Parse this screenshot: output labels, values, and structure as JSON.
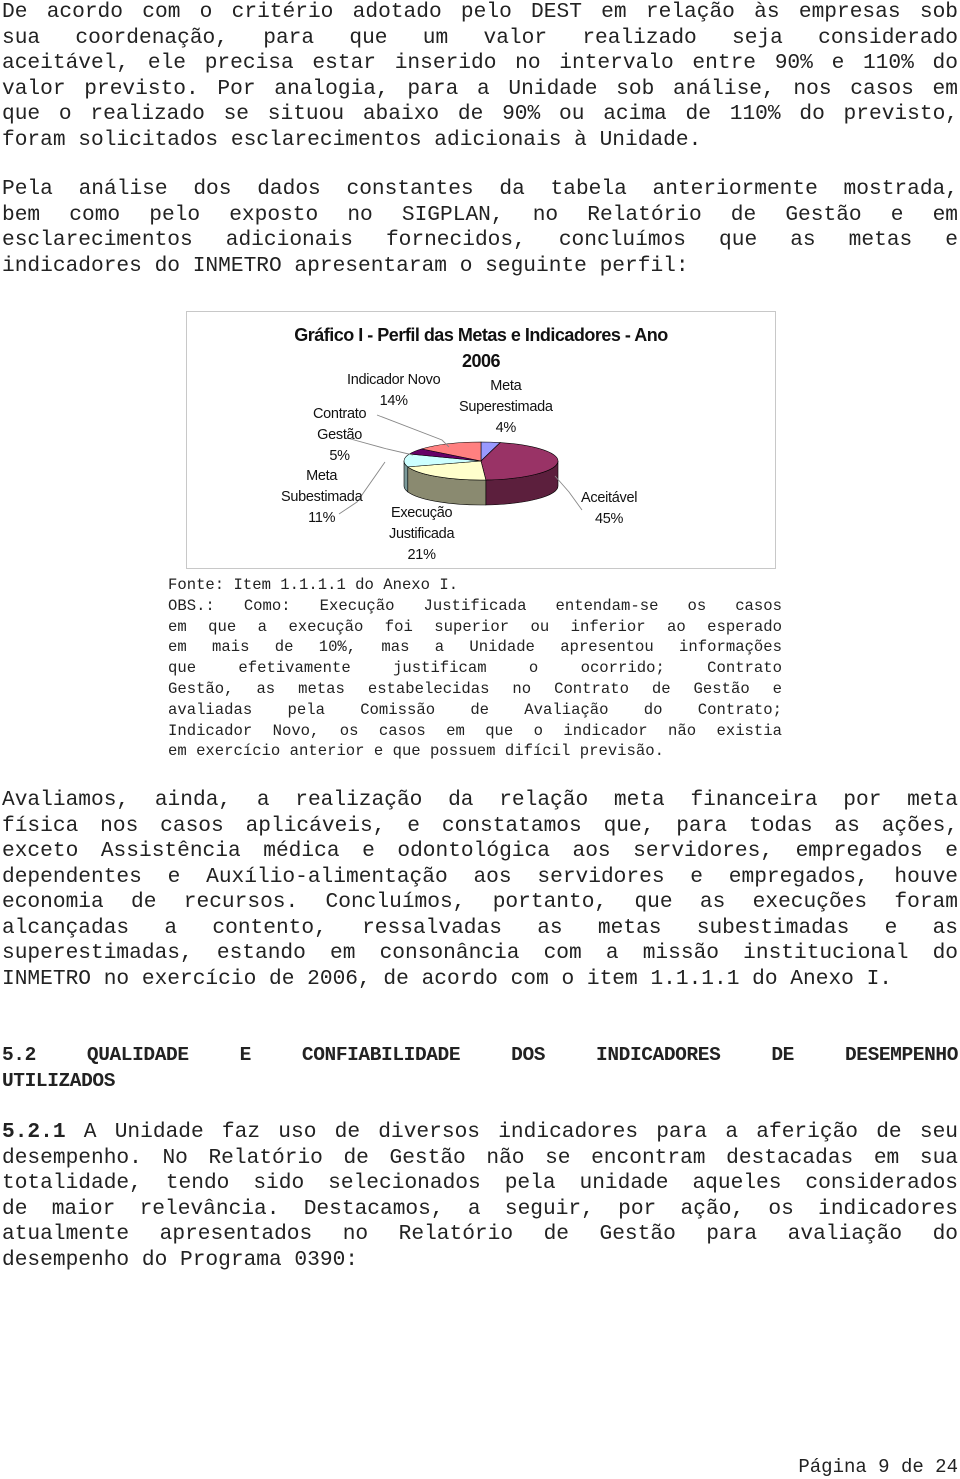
{
  "paragraph1": {
    "lines": [
      "De acordo com o critério adotado pelo DEST em relação às empresas sob",
      "sua coordenação, para que um valor realizado seja considerado",
      "aceitável, ele precisa estar inserido no intervalo entre 90% e 110% do",
      "valor previsto. Por analogia, para a Unidade sob análise, nos casos em",
      "que o realizado se situou abaixo de 90% ou acima de 110% do previsto,",
      "foram solicitados esclarecimentos adicionais à Unidade."
    ]
  },
  "paragraph2": {
    "lines": [
      "Pela análise dos dados constantes da tabela anteriormente mostrada,",
      "bem como pelo exposto no SIGPLAN, no Relatório de Gestão e em",
      "esclarecimentos adicionais fornecidos, concluímos que as metas e",
      "indicadores do INMETRO apresentaram o seguinte perfil:"
    ]
  },
  "chart_data": {
    "type": "pie",
    "title": "Gráfico I - Perfil das Metas e Indicadores - Ano 2006",
    "title_lines": [
      "Gráfico I - Perfil das Metas e Indicadores - Ano",
      "2006"
    ],
    "style": "3d-exploded-none",
    "slices": [
      {
        "label": "Meta Superestimada",
        "label_lines": [
          "Meta",
          "Superestimada",
          "4%"
        ],
        "value": 4,
        "color": "#9999ff",
        "side": "#5c5c99"
      },
      {
        "label": "Aceitável",
        "label_lines": [
          "Aceitável",
          "45%"
        ],
        "value": 45,
        "color": "#993366",
        "side": "#5c1f3d"
      },
      {
        "label": "Execução Justificada",
        "label_lines": [
          "Execução",
          "Justificada",
          "21%"
        ],
        "value": 21,
        "color": "#ffffcc",
        "side": "#8a8a70"
      },
      {
        "label": "Meta Subestimada",
        "label_lines": [
          "Meta",
          "Subestimada",
          "11%"
        ],
        "value": 11,
        "color": "#ccffff",
        "side": "#7a9999"
      },
      {
        "label": "Contrato Gestão",
        "label_lines": [
          "Contrato",
          "Gestão",
          "5%"
        ],
        "value": 5,
        "color": "#660066",
        "side": "#3d003d"
      },
      {
        "label": "Indicador Novo",
        "label_lines": [
          "Indicador Novo",
          "14%"
        ],
        "value": 14,
        "color": "#ff8080",
        "side": "#994d4d"
      }
    ],
    "legend": "none (data labels with leader lines)"
  },
  "source_note": {
    "lines": [
      "Fonte: Item 1.1.1.1 do Anexo I.",
      "OBS.: Como: Execução Justificada entendam-se os casos",
      "em que a execução foi superior ou inferior ao esperado",
      "em mais de 10%, mas a Unidade apresentou informações",
      "que efetivamente justificam o ocorrido; Contrato",
      "Gestão, as metas estabelecidas no Contrato de Gestão e",
      "avaliadas pela Comissão de Avaliação do Contrato;",
      "Indicador Novo, os casos em que o indicador não existia",
      "em exercício anterior e que possuem difícil previsão."
    ]
  },
  "paragraph3": {
    "lines": [
      "Avaliamos, ainda, a realização da relação meta financeira por meta",
      "física nos casos aplicáveis, e constatamos que, para todas as ações,",
      "exceto Assistência médica e odontológica aos servidores, empregados e",
      "dependentes e Auxílio-alimentação aos servidores e empregados, houve",
      "economia de recursos. Concluímos, portanto, que as execuções foram",
      "alcançadas a contento, ressalvadas as metas subestimadas e as",
      "superestimadas, estando em consonância com a missão institucional do",
      "INMETRO no exercício de 2006, de acordo com o item 1.1.1.1 do Anexo I."
    ]
  },
  "section_heading": {
    "lines": [
      "5.2 QUALIDADE E CONFIABILIDADE DOS INDICADORES DE DESEMPENHO",
      "UTILIZADOS"
    ]
  },
  "paragraph4": {
    "number": "5.2.1",
    "lines": [
      " A Unidade faz uso de diversos indicadores para a aferição de seu",
      "desempenho. No Relatório de Gestão não se encontram destacadas em sua",
      "totalidade, tendo sido selecionados pela unidade aqueles considerados",
      "de maior relevância. Destacamos, a seguir, por ação, os indicadores",
      "atualmente apresentados no Relatório de Gestão para avaliação do",
      "desempenho do Programa 0390:"
    ]
  },
  "footer": {
    "page_label": "Página 9 de 24"
  }
}
